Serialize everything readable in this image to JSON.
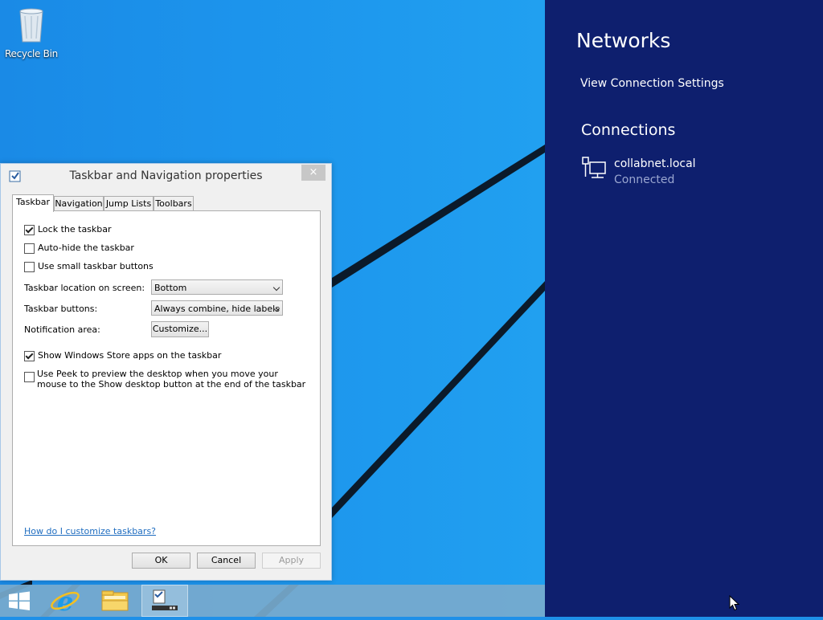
{
  "desktop": {
    "recycle_bin_label": "Recycle Bin"
  },
  "dialog": {
    "title": "Taskbar and Navigation properties",
    "close_glyph": "×",
    "tabs": [
      {
        "label": "Taskbar",
        "active": true
      },
      {
        "label": "Navigation",
        "active": false
      },
      {
        "label": "Jump Lists",
        "active": false
      },
      {
        "label": "Toolbars",
        "active": false
      }
    ],
    "options": {
      "lock_taskbar": {
        "label": "Lock the taskbar",
        "checked": true
      },
      "auto_hide": {
        "label": "Auto-hide the taskbar",
        "checked": false
      },
      "small_buttons": {
        "label": "Use small taskbar buttons",
        "checked": false
      },
      "store_apps": {
        "label": "Show Windows Store apps on the taskbar",
        "checked": true
      },
      "peek": {
        "label": "Use Peek to preview the desktop when you move your mouse to the Show desktop button at the end of the taskbar",
        "checked": false
      }
    },
    "location_label": "Taskbar location on screen:",
    "location_value": "Bottom",
    "buttons_label": "Taskbar buttons:",
    "buttons_value": "Always combine, hide labels",
    "notification_label": "Notification area:",
    "customize_label": "Customize...",
    "help_link": "How do I customize taskbars?",
    "ok_label": "OK",
    "cancel_label": "Cancel",
    "apply_label": "Apply"
  },
  "taskbar": {
    "items": [
      {
        "icon": "windows-start-icon"
      },
      {
        "icon": "internet-explorer-icon"
      },
      {
        "icon": "file-explorer-icon"
      },
      {
        "icon": "taskbar-properties-icon",
        "active": true
      }
    ]
  },
  "networks": {
    "title": "Networks",
    "view_settings": "View Connection Settings",
    "connections_heading": "Connections",
    "connection": {
      "name": "collabnet.local",
      "status": "Connected",
      "icon": "wired-network-icon"
    }
  },
  "colors": {
    "desktop_blue": "#1c94ec",
    "charm_bg": "#0e1f6e",
    "link": "#1f6dc0"
  }
}
